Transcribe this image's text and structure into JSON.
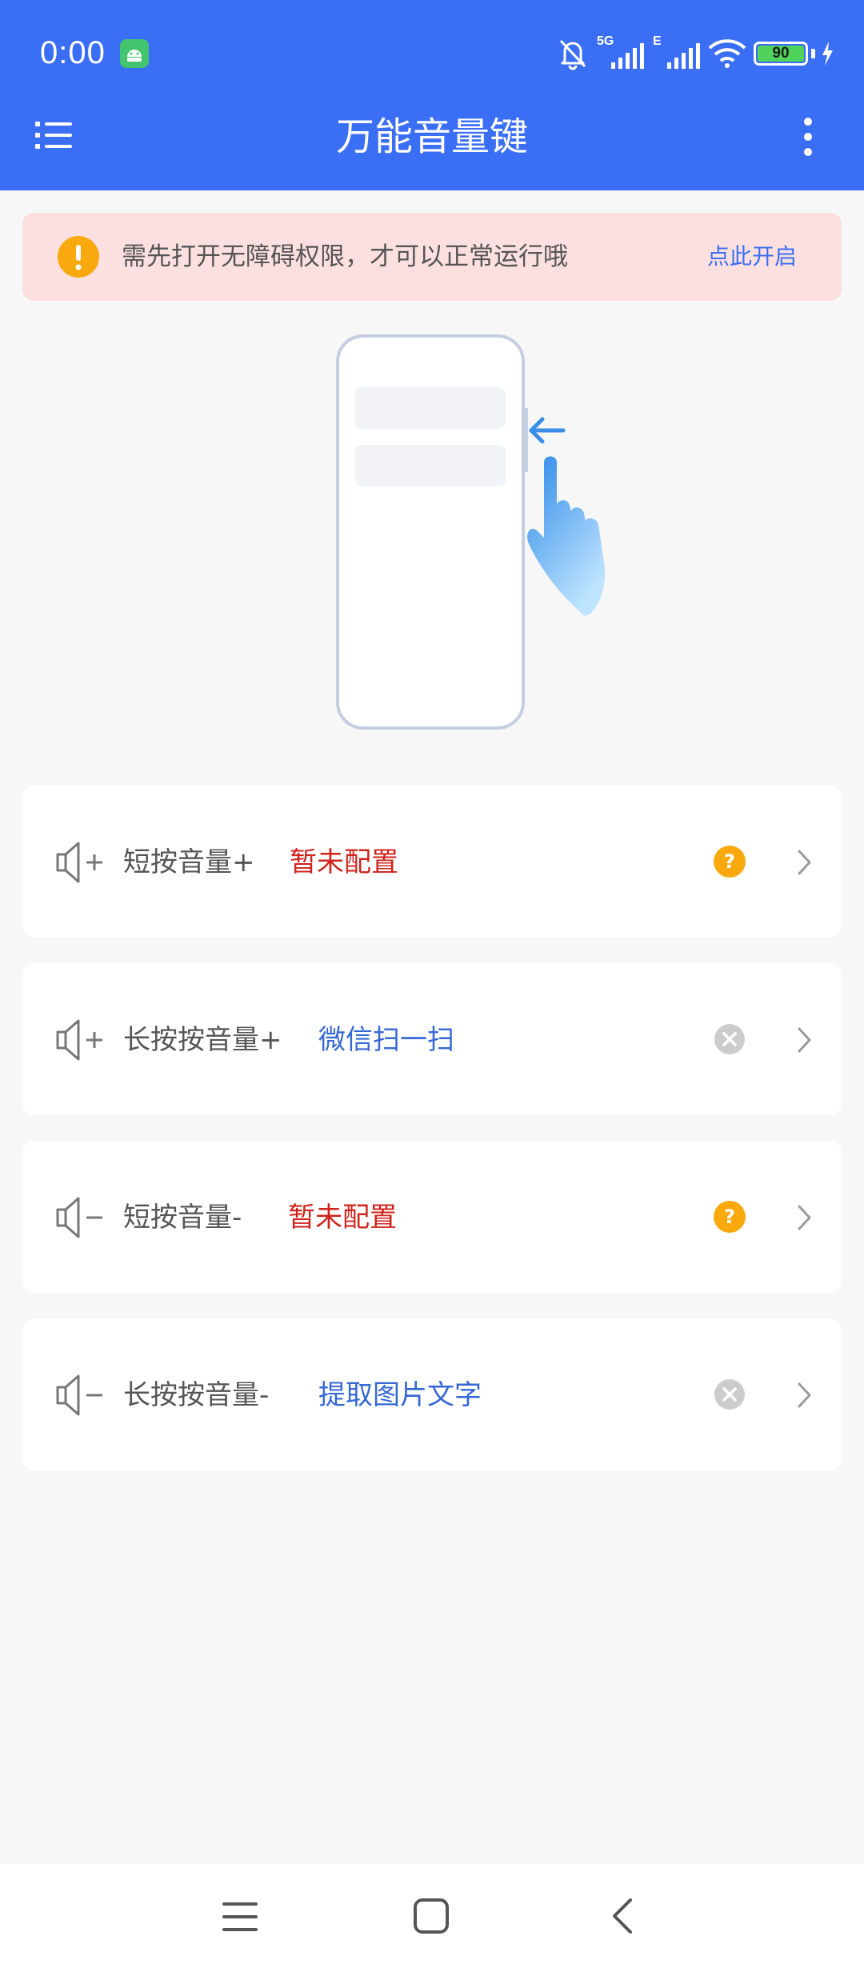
{
  "status_bar": {
    "time": "0:00",
    "battery": "90",
    "network1": "5G",
    "network2": "E"
  },
  "app_bar": {
    "title": "万能音量键",
    "menu_icon": "list-menu-icon",
    "more_icon": "more-vertical-icon"
  },
  "notice": {
    "text": "需先打开无障碍权限，才可以正常运行哦",
    "action": "点此开启",
    "icon": "warning-icon"
  },
  "cards": [
    {
      "label": "短按音量+",
      "value": "暂未配置",
      "value_color": "#d0231c",
      "status_icon": "question-icon"
    },
    {
      "label": "长按按音量+",
      "value": "微信扫一扫",
      "value_color": "#3568d4",
      "status_icon": "clear-icon"
    },
    {
      "label": "短按音量-",
      "value": "暂未配置",
      "value_color": "#d0231c",
      "status_icon": "question-icon"
    },
    {
      "label": "长按按音量-",
      "value": "提取图片文字",
      "value_color": "#3568d4",
      "status_icon": "clear-icon"
    }
  ],
  "colors": {
    "brand": "#3a6ff5",
    "notice_bg": "#fce0e0",
    "warning": "#f9a90e",
    "disabled": "#cccccc"
  },
  "nav": [
    "recents-icon",
    "home-icon",
    "back-icon"
  ]
}
